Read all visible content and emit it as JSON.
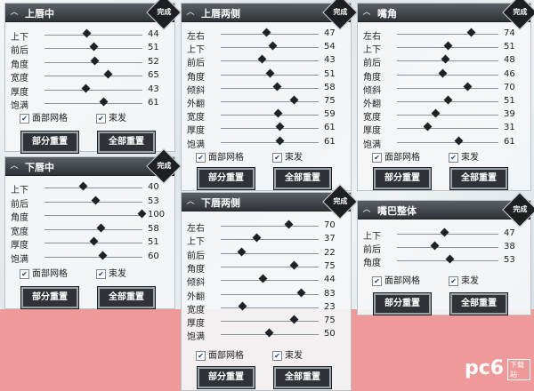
{
  "panels": [
    {
      "id": "upper-lip-mid",
      "title": "上唇中",
      "done": "完成",
      "sliders": [
        {
          "label": "上下",
          "value": 44
        },
        {
          "label": "前后",
          "value": 51
        },
        {
          "label": "角度",
          "value": 52
        },
        {
          "label": "宽度",
          "value": 65
        },
        {
          "label": "厚度",
          "value": 43
        },
        {
          "label": "饱满",
          "value": 61
        }
      ],
      "checks": [
        {
          "label": "面部网格",
          "checked": true
        },
        {
          "label": "束发",
          "checked": true
        }
      ],
      "buttons": [
        "部分重置",
        "全部重置"
      ]
    },
    {
      "id": "lower-lip-mid",
      "title": "下唇中",
      "done": "完成",
      "sliders": [
        {
          "label": "上下",
          "value": 40
        },
        {
          "label": "前后",
          "value": 53
        },
        {
          "label": "角度",
          "value": 100
        },
        {
          "label": "宽度",
          "value": 58
        },
        {
          "label": "厚度",
          "value": 51
        },
        {
          "label": "饱满",
          "value": 60
        }
      ],
      "checks": [
        {
          "label": "面部网格",
          "checked": true
        },
        {
          "label": "束发",
          "checked": true
        }
      ],
      "buttons": [
        "部分重置",
        "全部重置"
      ]
    },
    {
      "id": "upper-lip-sides",
      "title": "上唇两侧",
      "done": "完成",
      "sliders": [
        {
          "label": "左右",
          "value": 47
        },
        {
          "label": "上下",
          "value": 54
        },
        {
          "label": "前后",
          "value": 43
        },
        {
          "label": "角度",
          "value": 51
        },
        {
          "label": "倾斜",
          "value": 58
        },
        {
          "label": "外翻",
          "value": 75
        },
        {
          "label": "宽度",
          "value": 59
        },
        {
          "label": "厚度",
          "value": 61
        },
        {
          "label": "饱满",
          "value": 61
        }
      ],
      "checks": [
        {
          "label": "面部网格",
          "checked": true
        },
        {
          "label": "束发",
          "checked": true
        }
      ],
      "buttons": [
        "部分重置",
        "全部重置"
      ]
    },
    {
      "id": "lower-lip-sides",
      "title": "下唇两侧",
      "done": "完成",
      "sliders": [
        {
          "label": "左右",
          "value": 70
        },
        {
          "label": "上下",
          "value": 37
        },
        {
          "label": "前后",
          "value": 22
        },
        {
          "label": "角度",
          "value": 75
        },
        {
          "label": "倾斜",
          "value": 44
        },
        {
          "label": "外翻",
          "value": 83
        },
        {
          "label": "宽度",
          "value": 23
        },
        {
          "label": "厚度",
          "value": 75
        },
        {
          "label": "饱满",
          "value": 50
        }
      ],
      "checks": [
        {
          "label": "面部网格",
          "checked": true
        },
        {
          "label": "束发",
          "checked": true
        }
      ],
      "buttons": [
        "部分重置",
        "全部重置"
      ]
    },
    {
      "id": "mouth-corner",
      "title": "嘴角",
      "done": "完成",
      "sliders": [
        {
          "label": "左右",
          "value": 74
        },
        {
          "label": "上下",
          "value": 51
        },
        {
          "label": "前后",
          "value": 48
        },
        {
          "label": "角度",
          "value": 46
        },
        {
          "label": "倾斜",
          "value": 70
        },
        {
          "label": "外翻",
          "value": 51
        },
        {
          "label": "宽度",
          "value": 39
        },
        {
          "label": "厚度",
          "value": 31
        },
        {
          "label": "饱满",
          "value": 61
        }
      ],
      "checks": [
        {
          "label": "面部网格",
          "checked": true
        },
        {
          "label": "束发",
          "checked": true
        }
      ],
      "buttons": [
        "部分重置",
        "全部重置"
      ]
    },
    {
      "id": "mouth-whole",
      "title": "嘴巴整体",
      "done": "完成",
      "sliders": [
        {
          "label": "上下",
          "value": 47
        },
        {
          "label": "前后",
          "value": 38
        },
        {
          "label": "角度",
          "value": 53
        }
      ],
      "checks": [
        {
          "label": "面部网格",
          "checked": true
        },
        {
          "label": "束发",
          "checked": true
        }
      ],
      "buttons": [
        "部分重置",
        "全部重置"
      ]
    }
  ],
  "watermark": {
    "brand": "pc6",
    "sub": "下载站"
  },
  "colors": {
    "header": "#2f3338",
    "accent_bg": "#ef9a9a",
    "thumb": "#1e2226"
  }
}
